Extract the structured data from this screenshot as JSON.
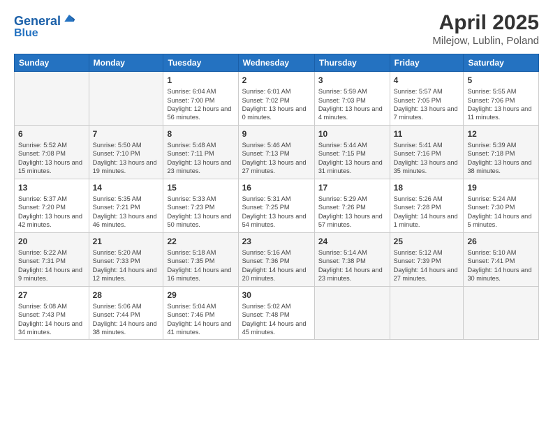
{
  "header": {
    "logo_line1": "General",
    "logo_line2": "Blue",
    "title": "April 2025",
    "subtitle": "Milejow, Lublin, Poland"
  },
  "calendar": {
    "days_of_week": [
      "Sunday",
      "Monday",
      "Tuesday",
      "Wednesday",
      "Thursday",
      "Friday",
      "Saturday"
    ],
    "weeks": [
      [
        {
          "day": "",
          "info": ""
        },
        {
          "day": "",
          "info": ""
        },
        {
          "day": "1",
          "info": "Sunrise: 6:04 AM\nSunset: 7:00 PM\nDaylight: 12 hours and 56 minutes."
        },
        {
          "day": "2",
          "info": "Sunrise: 6:01 AM\nSunset: 7:02 PM\nDaylight: 13 hours and 0 minutes."
        },
        {
          "day": "3",
          "info": "Sunrise: 5:59 AM\nSunset: 7:03 PM\nDaylight: 13 hours and 4 minutes."
        },
        {
          "day": "4",
          "info": "Sunrise: 5:57 AM\nSunset: 7:05 PM\nDaylight: 13 hours and 7 minutes."
        },
        {
          "day": "5",
          "info": "Sunrise: 5:55 AM\nSunset: 7:06 PM\nDaylight: 13 hours and 11 minutes."
        }
      ],
      [
        {
          "day": "6",
          "info": "Sunrise: 5:52 AM\nSunset: 7:08 PM\nDaylight: 13 hours and 15 minutes."
        },
        {
          "day": "7",
          "info": "Sunrise: 5:50 AM\nSunset: 7:10 PM\nDaylight: 13 hours and 19 minutes."
        },
        {
          "day": "8",
          "info": "Sunrise: 5:48 AM\nSunset: 7:11 PM\nDaylight: 13 hours and 23 minutes."
        },
        {
          "day": "9",
          "info": "Sunrise: 5:46 AM\nSunset: 7:13 PM\nDaylight: 13 hours and 27 minutes."
        },
        {
          "day": "10",
          "info": "Sunrise: 5:44 AM\nSunset: 7:15 PM\nDaylight: 13 hours and 31 minutes."
        },
        {
          "day": "11",
          "info": "Sunrise: 5:41 AM\nSunset: 7:16 PM\nDaylight: 13 hours and 35 minutes."
        },
        {
          "day": "12",
          "info": "Sunrise: 5:39 AM\nSunset: 7:18 PM\nDaylight: 13 hours and 38 minutes."
        }
      ],
      [
        {
          "day": "13",
          "info": "Sunrise: 5:37 AM\nSunset: 7:20 PM\nDaylight: 13 hours and 42 minutes."
        },
        {
          "day": "14",
          "info": "Sunrise: 5:35 AM\nSunset: 7:21 PM\nDaylight: 13 hours and 46 minutes."
        },
        {
          "day": "15",
          "info": "Sunrise: 5:33 AM\nSunset: 7:23 PM\nDaylight: 13 hours and 50 minutes."
        },
        {
          "day": "16",
          "info": "Sunrise: 5:31 AM\nSunset: 7:25 PM\nDaylight: 13 hours and 54 minutes."
        },
        {
          "day": "17",
          "info": "Sunrise: 5:29 AM\nSunset: 7:26 PM\nDaylight: 13 hours and 57 minutes."
        },
        {
          "day": "18",
          "info": "Sunrise: 5:26 AM\nSunset: 7:28 PM\nDaylight: 14 hours and 1 minute."
        },
        {
          "day": "19",
          "info": "Sunrise: 5:24 AM\nSunset: 7:30 PM\nDaylight: 14 hours and 5 minutes."
        }
      ],
      [
        {
          "day": "20",
          "info": "Sunrise: 5:22 AM\nSunset: 7:31 PM\nDaylight: 14 hours and 9 minutes."
        },
        {
          "day": "21",
          "info": "Sunrise: 5:20 AM\nSunset: 7:33 PM\nDaylight: 14 hours and 12 minutes."
        },
        {
          "day": "22",
          "info": "Sunrise: 5:18 AM\nSunset: 7:35 PM\nDaylight: 14 hours and 16 minutes."
        },
        {
          "day": "23",
          "info": "Sunrise: 5:16 AM\nSunset: 7:36 PM\nDaylight: 14 hours and 20 minutes."
        },
        {
          "day": "24",
          "info": "Sunrise: 5:14 AM\nSunset: 7:38 PM\nDaylight: 14 hours and 23 minutes."
        },
        {
          "day": "25",
          "info": "Sunrise: 5:12 AM\nSunset: 7:39 PM\nDaylight: 14 hours and 27 minutes."
        },
        {
          "day": "26",
          "info": "Sunrise: 5:10 AM\nSunset: 7:41 PM\nDaylight: 14 hours and 30 minutes."
        }
      ],
      [
        {
          "day": "27",
          "info": "Sunrise: 5:08 AM\nSunset: 7:43 PM\nDaylight: 14 hours and 34 minutes."
        },
        {
          "day": "28",
          "info": "Sunrise: 5:06 AM\nSunset: 7:44 PM\nDaylight: 14 hours and 38 minutes."
        },
        {
          "day": "29",
          "info": "Sunrise: 5:04 AM\nSunset: 7:46 PM\nDaylight: 14 hours and 41 minutes."
        },
        {
          "day": "30",
          "info": "Sunrise: 5:02 AM\nSunset: 7:48 PM\nDaylight: 14 hours and 45 minutes."
        },
        {
          "day": "",
          "info": ""
        },
        {
          "day": "",
          "info": ""
        },
        {
          "day": "",
          "info": ""
        }
      ]
    ]
  }
}
